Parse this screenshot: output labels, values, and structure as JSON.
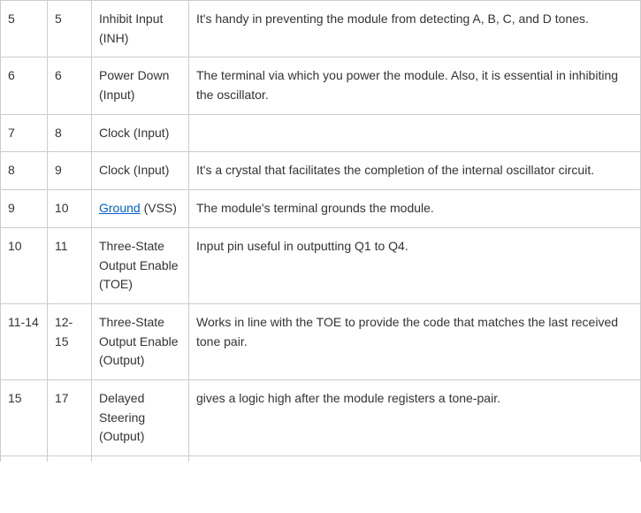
{
  "rows": [
    {
      "a": "5",
      "b": "5",
      "c_pre": "Inhibit Input (INH)",
      "d": "It's handy in preventing the module from detecting A, B, C, and D tones."
    },
    {
      "a": "6",
      "b": "6",
      "c_pre": "Power Down (Input)",
      "d": "The terminal via which you power the module. Also, it is essential in inhibiting the oscillator."
    },
    {
      "a": "7",
      "b": "8",
      "c_pre": "Clock (Input)",
      "d": ""
    },
    {
      "a": "8",
      "b": "9",
      "c_pre": "Clock (Input)",
      "d": "It's a crystal that facilitates the completion of the internal oscillator circuit."
    },
    {
      "a": "9",
      "b": "10",
      "c_link": "Ground",
      "c_post": " (VSS)",
      "d": "The module's terminal grounds the module."
    },
    {
      "a": "10",
      "b": "11",
      "c_pre": "Three-State Output Enable (TOE)",
      "d": "Input pin useful in outputting Q1 to Q4."
    },
    {
      "a": "11-14",
      "b": "12-15",
      "c_pre": "Three-State Output Enable (Output)",
      "d": "Works in line with the TOE to provide the code that matches the last received tone pair."
    },
    {
      "a": "15",
      "b": "17",
      "c_pre": "Delayed Steering (Output)",
      "d": "gives a logic high after the module registers a  tone-pair."
    }
  ]
}
